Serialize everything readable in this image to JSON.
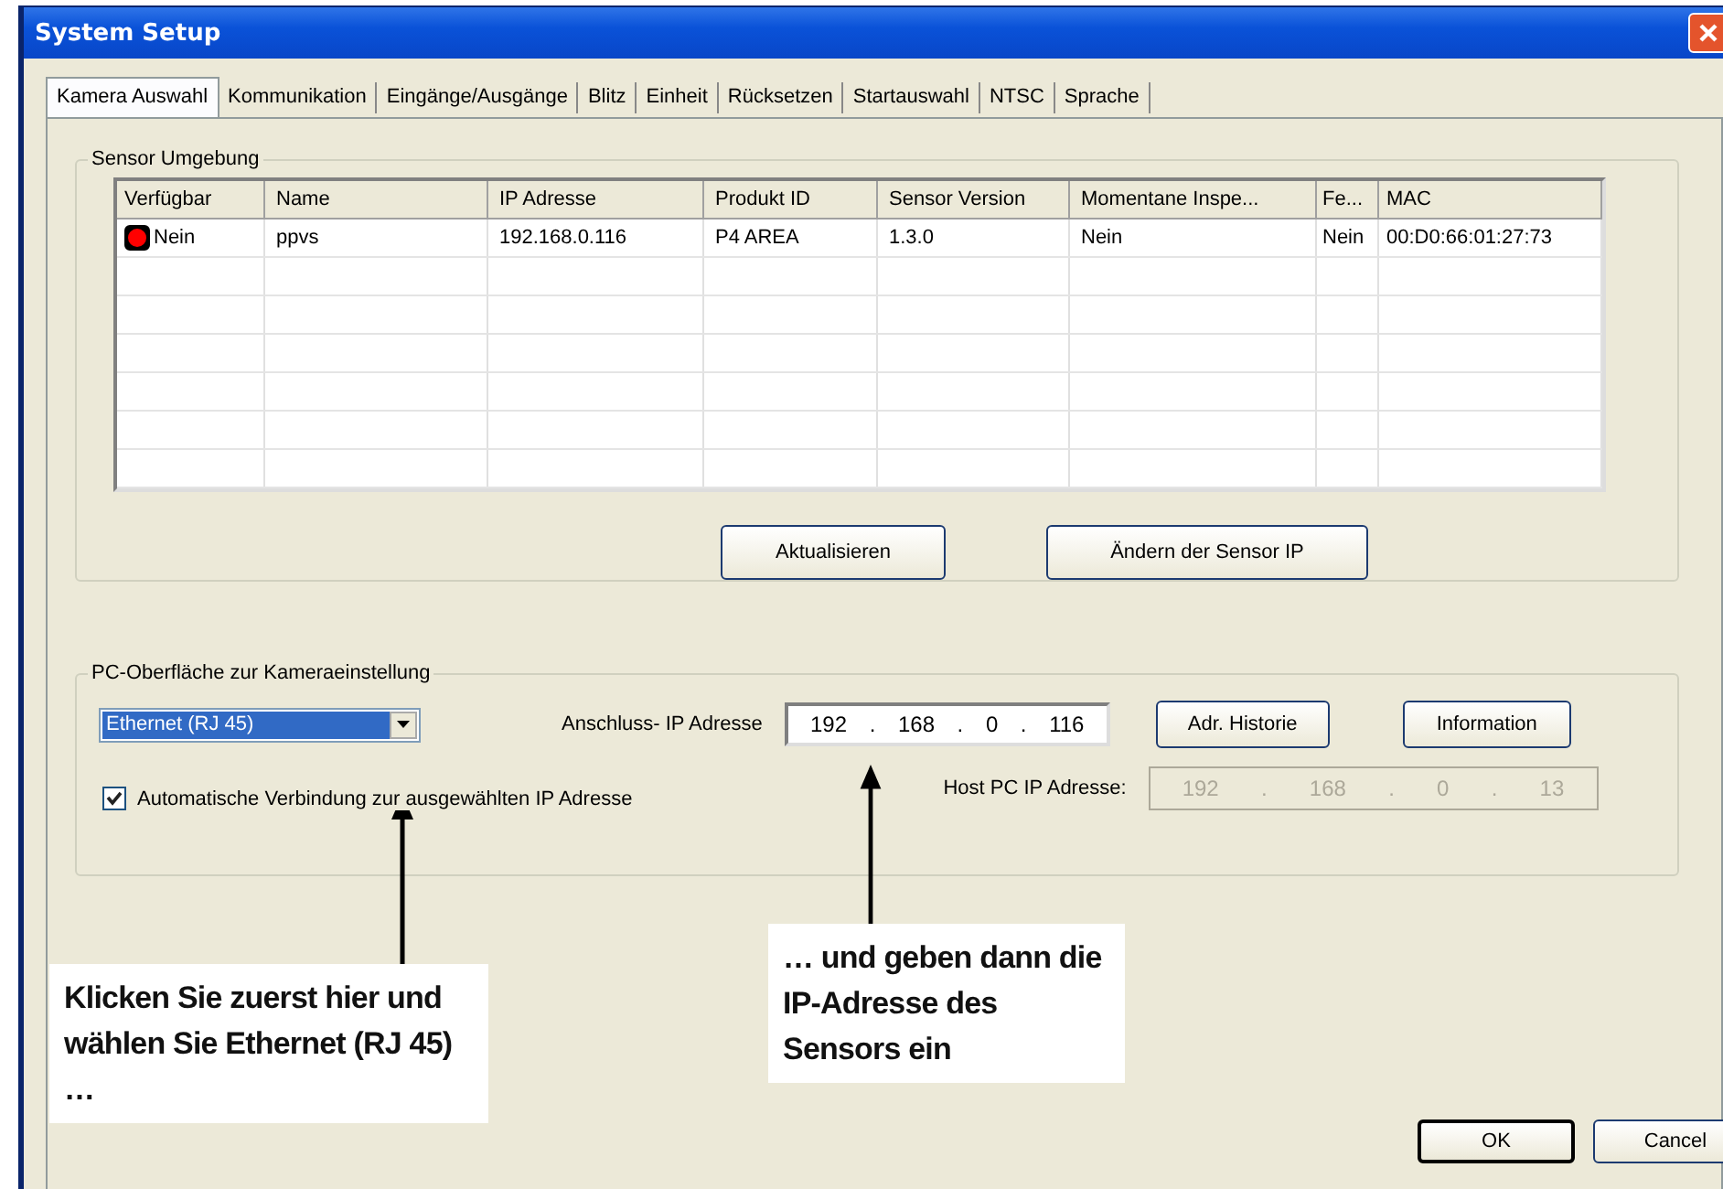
{
  "window": {
    "title": "System Setup"
  },
  "tabs": [
    {
      "label": "Kamera Auswahl",
      "selected": true
    },
    {
      "label": "Kommunikation",
      "selected": false
    },
    {
      "label": "Eingänge/Ausgänge",
      "selected": false
    },
    {
      "label": "Blitz",
      "selected": false
    },
    {
      "label": "Einheit",
      "selected": false
    },
    {
      "label": "Rücksetzen",
      "selected": false
    },
    {
      "label": "Startauswahl",
      "selected": false
    },
    {
      "label": "NTSC",
      "selected": false
    },
    {
      "label": "Sprache",
      "selected": false
    }
  ],
  "sensor_group": {
    "title": "Sensor Umgebung",
    "table": {
      "columns": [
        "Verfügbar",
        "Name",
        "IP Adresse",
        "Produkt ID",
        "Sensor Version",
        "Momentane Inspe...",
        "Fe...",
        "MAC"
      ],
      "rows": [
        {
          "available": false,
          "cells": [
            "Nein",
            "ppvs",
            "192.168.0.116",
            "P4 AREA",
            "1.3.0",
            "Nein",
            "Nein",
            "00:D0:66:01:27:73"
          ]
        }
      ]
    },
    "buttons": [
      "Aktualisieren",
      "Ändern der Sensor IP"
    ]
  },
  "pc_group": {
    "title": "PC-Oberfläche zur Kameraeinstellung",
    "interface_dropdown": {
      "value": "Ethernet (RJ 45)"
    },
    "ip_label": "Anschluss- IP Adresse",
    "ip_octets": [
      "192",
      "168",
      "0",
      "116"
    ],
    "octet_separator": ".",
    "buttons": [
      "Adr. Historie",
      "Information"
    ],
    "auto_connect": {
      "label": "Automatische Verbindung zur ausgewählten IP Adresse",
      "checked": true
    },
    "host_label": "Host PC IP Adresse:",
    "host_octets": {
      "disabled": true,
      "values": [
        "192",
        "168",
        "0",
        "13"
      ]
    }
  },
  "callouts": [
    "Klicken Sie zuerst hier und wählen Sie Ethernet (RJ 45) …",
    "… und geben dann die IP-Adresse des Sensors ein"
  ],
  "footer_buttons": [
    "OK",
    "Cancel"
  ]
}
